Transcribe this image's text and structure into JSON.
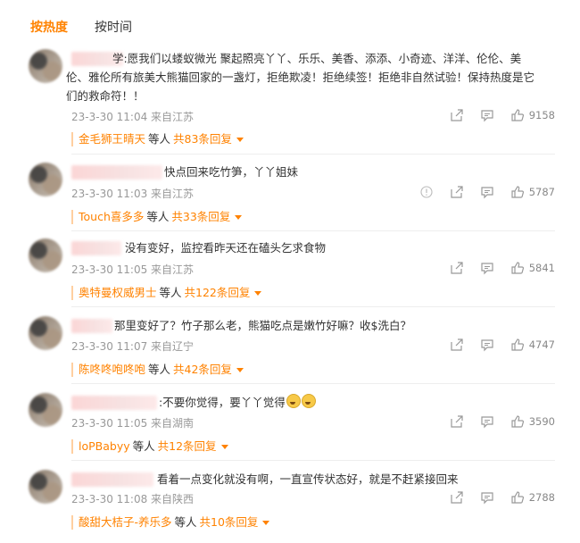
{
  "tabs": [
    {
      "label": "按热度"
    },
    {
      "label": "按时间"
    }
  ],
  "comments": [
    {
      "line1": "学:愿我们以蝼蚁微光  聚起照亮丫丫、乐乐、美香、添添、小奇迹、洋洋、伦伦、美",
      "line2": "伦、雅伦所有旅美大熊猫回家的一盏灯，拒绝欺凌！拒绝续签！拒绝非自然试验！保持热度是它",
      "line3": "们的救命符！！",
      "meta": "23-3-30 11:04 来自江苏",
      "likes": "9158",
      "reply_user": "金毛狮王晴天",
      "reply_mid": "等人",
      "reply_total": "共83条回复"
    },
    {
      "line1": "快点回来吃竹笋，丫丫姐妹",
      "meta": "23-3-30 11:03 来自江苏",
      "likes": "5787",
      "reply_user": "Touch喜多多",
      "reply_mid": "等人",
      "reply_total": "共33条回复"
    },
    {
      "line1": "没有变好，监控看昨天还在磕头乞求食物",
      "meta": "23-3-30 11:05 来自江苏",
      "likes": "5841",
      "reply_user": "奥特曼权威男士",
      "reply_mid": "等人",
      "reply_total": "共122条回复"
    },
    {
      "line1": "那里变好了？竹子那么老，熊猫吃点是嫩竹好嘛？收$洗白？",
      "meta": "23-3-30 11:07 来自辽宁",
      "likes": "4747",
      "reply_user": "陈咚咚咆咚咆",
      "reply_mid": "等人",
      "reply_total": "共42条回复"
    },
    {
      "line1": ":不要你觉得，要丫丫觉得",
      "meta": "23-3-30 11:05 来自湖南",
      "likes": "3590",
      "reply_user": "loPBabyy",
      "reply_mid": "等人",
      "reply_total": "共12条回复"
    },
    {
      "line1": "看着一点变化就没有啊，一直宣传状态好，就是不赶紧接回来",
      "meta": "23-3-30 11:08 来自陕西",
      "likes": "2788",
      "reply_user": "酸甜大桔子-养乐多",
      "reply_mid": "等人",
      "reply_total": "共10条回复"
    }
  ],
  "icons": {
    "share": "share-icon",
    "comment": "comment-icon",
    "like": "thumbs-up-icon",
    "report": "report-icon",
    "expand": "caret-down-icon"
  },
  "colors": {
    "accent": "#ff8200",
    "meta": "#999999"
  }
}
